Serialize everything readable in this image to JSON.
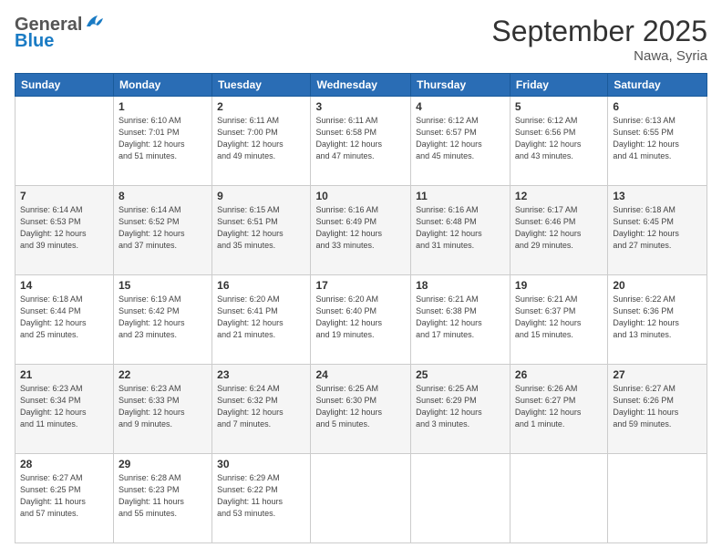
{
  "header": {
    "logo_general": "General",
    "logo_blue": "Blue",
    "month_title": "September 2025",
    "location": "Nawa, Syria"
  },
  "columns": [
    "Sunday",
    "Monday",
    "Tuesday",
    "Wednesday",
    "Thursday",
    "Friday",
    "Saturday"
  ],
  "weeks": [
    [
      {
        "day": "",
        "info": ""
      },
      {
        "day": "1",
        "info": "Sunrise: 6:10 AM\nSunset: 7:01 PM\nDaylight: 12 hours\nand 51 minutes."
      },
      {
        "day": "2",
        "info": "Sunrise: 6:11 AM\nSunset: 7:00 PM\nDaylight: 12 hours\nand 49 minutes."
      },
      {
        "day": "3",
        "info": "Sunrise: 6:11 AM\nSunset: 6:58 PM\nDaylight: 12 hours\nand 47 minutes."
      },
      {
        "day": "4",
        "info": "Sunrise: 6:12 AM\nSunset: 6:57 PM\nDaylight: 12 hours\nand 45 minutes."
      },
      {
        "day": "5",
        "info": "Sunrise: 6:12 AM\nSunset: 6:56 PM\nDaylight: 12 hours\nand 43 minutes."
      },
      {
        "day": "6",
        "info": "Sunrise: 6:13 AM\nSunset: 6:55 PM\nDaylight: 12 hours\nand 41 minutes."
      }
    ],
    [
      {
        "day": "7",
        "info": "Sunrise: 6:14 AM\nSunset: 6:53 PM\nDaylight: 12 hours\nand 39 minutes."
      },
      {
        "day": "8",
        "info": "Sunrise: 6:14 AM\nSunset: 6:52 PM\nDaylight: 12 hours\nand 37 minutes."
      },
      {
        "day": "9",
        "info": "Sunrise: 6:15 AM\nSunset: 6:51 PM\nDaylight: 12 hours\nand 35 minutes."
      },
      {
        "day": "10",
        "info": "Sunrise: 6:16 AM\nSunset: 6:49 PM\nDaylight: 12 hours\nand 33 minutes."
      },
      {
        "day": "11",
        "info": "Sunrise: 6:16 AM\nSunset: 6:48 PM\nDaylight: 12 hours\nand 31 minutes."
      },
      {
        "day": "12",
        "info": "Sunrise: 6:17 AM\nSunset: 6:46 PM\nDaylight: 12 hours\nand 29 minutes."
      },
      {
        "day": "13",
        "info": "Sunrise: 6:18 AM\nSunset: 6:45 PM\nDaylight: 12 hours\nand 27 minutes."
      }
    ],
    [
      {
        "day": "14",
        "info": "Sunrise: 6:18 AM\nSunset: 6:44 PM\nDaylight: 12 hours\nand 25 minutes."
      },
      {
        "day": "15",
        "info": "Sunrise: 6:19 AM\nSunset: 6:42 PM\nDaylight: 12 hours\nand 23 minutes."
      },
      {
        "day": "16",
        "info": "Sunrise: 6:20 AM\nSunset: 6:41 PM\nDaylight: 12 hours\nand 21 minutes."
      },
      {
        "day": "17",
        "info": "Sunrise: 6:20 AM\nSunset: 6:40 PM\nDaylight: 12 hours\nand 19 minutes."
      },
      {
        "day": "18",
        "info": "Sunrise: 6:21 AM\nSunset: 6:38 PM\nDaylight: 12 hours\nand 17 minutes."
      },
      {
        "day": "19",
        "info": "Sunrise: 6:21 AM\nSunset: 6:37 PM\nDaylight: 12 hours\nand 15 minutes."
      },
      {
        "day": "20",
        "info": "Sunrise: 6:22 AM\nSunset: 6:36 PM\nDaylight: 12 hours\nand 13 minutes."
      }
    ],
    [
      {
        "day": "21",
        "info": "Sunrise: 6:23 AM\nSunset: 6:34 PM\nDaylight: 12 hours\nand 11 minutes."
      },
      {
        "day": "22",
        "info": "Sunrise: 6:23 AM\nSunset: 6:33 PM\nDaylight: 12 hours\nand 9 minutes."
      },
      {
        "day": "23",
        "info": "Sunrise: 6:24 AM\nSunset: 6:32 PM\nDaylight: 12 hours\nand 7 minutes."
      },
      {
        "day": "24",
        "info": "Sunrise: 6:25 AM\nSunset: 6:30 PM\nDaylight: 12 hours\nand 5 minutes."
      },
      {
        "day": "25",
        "info": "Sunrise: 6:25 AM\nSunset: 6:29 PM\nDaylight: 12 hours\nand 3 minutes."
      },
      {
        "day": "26",
        "info": "Sunrise: 6:26 AM\nSunset: 6:27 PM\nDaylight: 12 hours\nand 1 minute."
      },
      {
        "day": "27",
        "info": "Sunrise: 6:27 AM\nSunset: 6:26 PM\nDaylight: 11 hours\nand 59 minutes."
      }
    ],
    [
      {
        "day": "28",
        "info": "Sunrise: 6:27 AM\nSunset: 6:25 PM\nDaylight: 11 hours\nand 57 minutes."
      },
      {
        "day": "29",
        "info": "Sunrise: 6:28 AM\nSunset: 6:23 PM\nDaylight: 11 hours\nand 55 minutes."
      },
      {
        "day": "30",
        "info": "Sunrise: 6:29 AM\nSunset: 6:22 PM\nDaylight: 11 hours\nand 53 minutes."
      },
      {
        "day": "",
        "info": ""
      },
      {
        "day": "",
        "info": ""
      },
      {
        "day": "",
        "info": ""
      },
      {
        "day": "",
        "info": ""
      }
    ]
  ]
}
